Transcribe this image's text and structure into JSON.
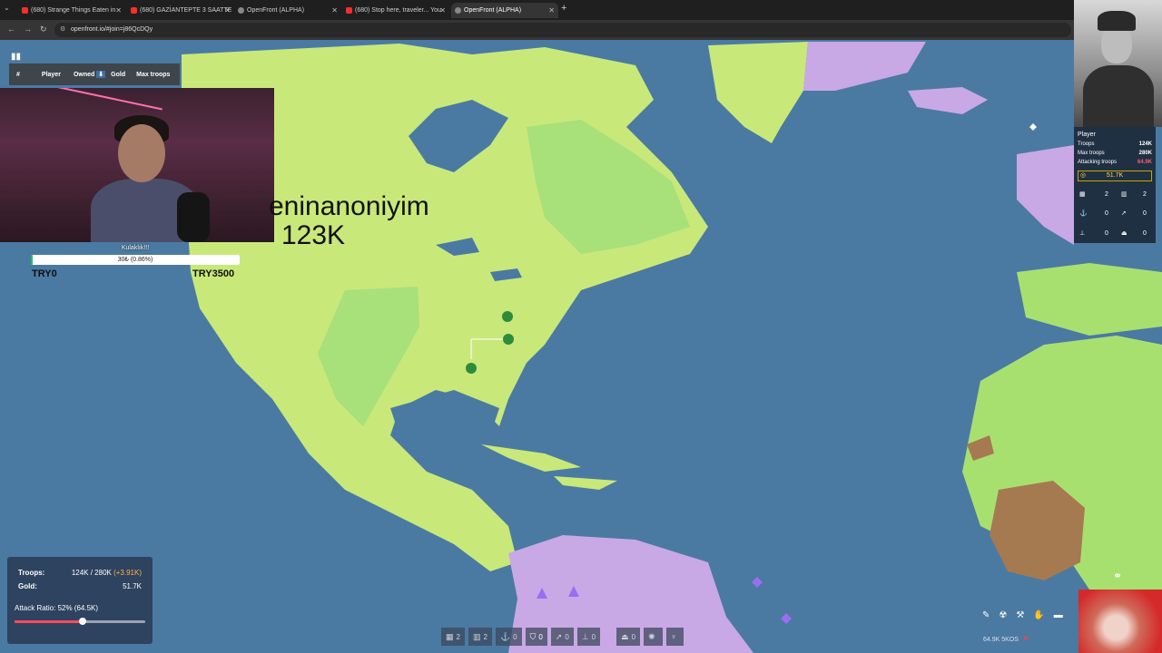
{
  "browser": {
    "tabs": [
      {
        "title": "(680) Strange Things Eaten in",
        "favicon": "youtube-icon",
        "active": false
      },
      {
        "title": "(680) GAZİANTEPTE 3 SAATTE",
        "favicon": "youtube-icon",
        "active": false
      },
      {
        "title": "OpenFront (ALPHA)",
        "favicon": "globe-icon",
        "active": false
      },
      {
        "title": "(680) Stop here, traveler... You",
        "favicon": "youtube-icon",
        "active": false
      },
      {
        "title": "OpenFront (ALPHA)",
        "favicon": "globe-icon",
        "active": true
      }
    ],
    "url": "openfront.io/#join=j86QcDQy"
  },
  "leaderboard": {
    "col_rank": "#",
    "col_player": "Player",
    "col_owned": "Owned",
    "col_gold": "Gold",
    "col_max_troops": "Max troops"
  },
  "donation": {
    "title": "Kulaklık!!!",
    "progress_text": "30₺ (0.86%)",
    "progress_fraction": 0.0086,
    "min_label": "TRY0",
    "max_label": "TRY3500"
  },
  "map": {
    "player_name": "eninanoniyim",
    "player_troops": "123K"
  },
  "player_panel": {
    "title": "Player",
    "troops_label": "Troops",
    "troops_value": "124K",
    "max_troops_label": "Max troops",
    "max_troops_value": "280K",
    "attacking_label": "Attacking troops",
    "attacking_value": "64.9K",
    "gold": "51.7K",
    "cities": "2",
    "factories": "2",
    "ports": "0",
    "missiles": "0",
    "defense": "0",
    "warships": "0"
  },
  "speed_text": "64.9K 5KOS",
  "stats": {
    "troops_label": "Troops:",
    "troops_value": "124K / 280K",
    "troops_increase": "(+3.91K)",
    "gold_label": "Gold:",
    "gold_value": "51.7K",
    "attack_ratio_label": "Attack Ratio: 52% (64.5K)",
    "attack_ratio": 0.52
  },
  "action_bar": [
    {
      "icon": "city-icon",
      "count": "2"
    },
    {
      "icon": "factory-icon",
      "count": "2"
    },
    {
      "icon": "port-icon",
      "count": "0"
    },
    {
      "icon": "shield-icon",
      "count": "0"
    },
    {
      "icon": "missile-silo-icon",
      "count": "0"
    },
    {
      "icon": "sam-icon",
      "count": "0"
    },
    {
      "icon": "warship-icon",
      "count": "0"
    },
    {
      "icon": "atom-bomb-icon",
      "count": ""
    },
    {
      "icon": "hydrogen-bomb-icon",
      "count": ""
    }
  ],
  "colors": {
    "ocean": "#4a7aa2",
    "player_land": "#c9e87a",
    "player_land_light": "#a8e07a",
    "enemy_purple": "#c9a8e6",
    "enemy_brown": "#a57a50",
    "enemy_green": "#a8e070"
  }
}
